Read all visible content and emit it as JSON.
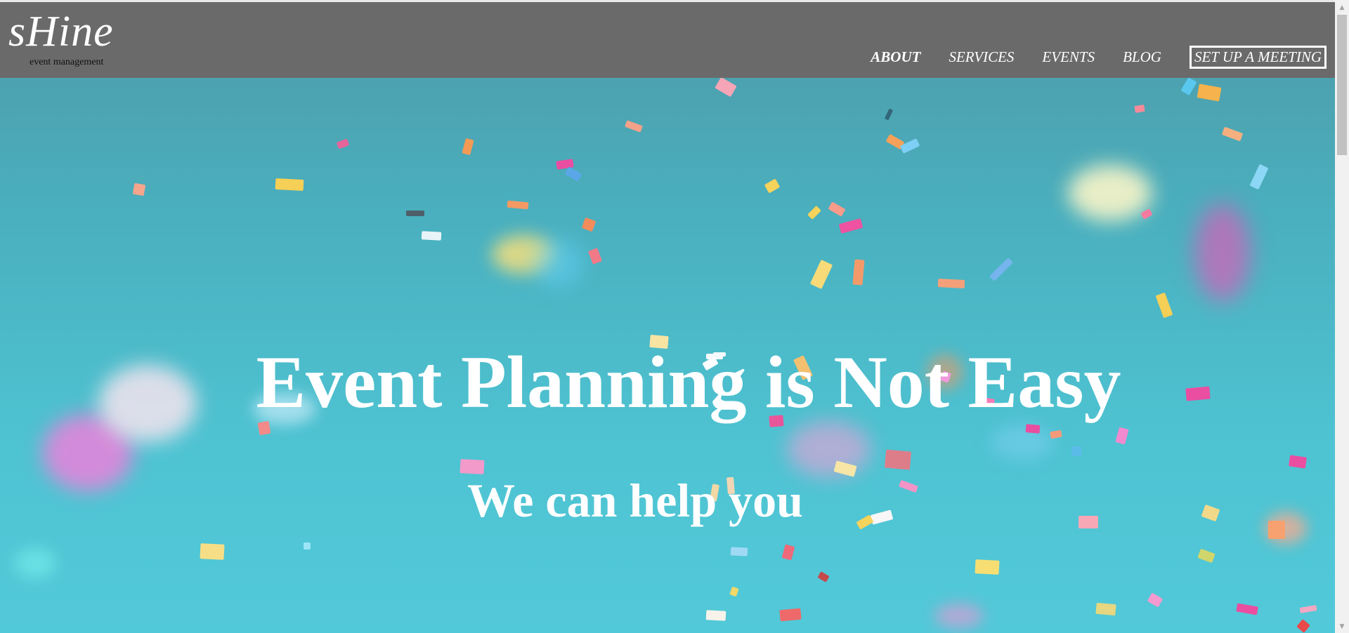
{
  "brand": {
    "name": "sHine",
    "tagline": "event management"
  },
  "nav": {
    "items": [
      {
        "label": "ABOUT",
        "active": true
      },
      {
        "label": "SERVICES"
      },
      {
        "label": "EVENTS"
      },
      {
        "label": "BLOG"
      },
      {
        "label": "SET UP A MEETING",
        "cta": true
      }
    ]
  },
  "hero": {
    "headline": "Event Planning is Not Easy",
    "subheadline": "We can help you"
  },
  "colors": {
    "navbar": "#6a6a6a",
    "hero_teal": "#4ec3d2",
    "text": "#ffffff"
  },
  "icons": {
    "scroll_up": "▲",
    "scroll_down": "▼"
  }
}
